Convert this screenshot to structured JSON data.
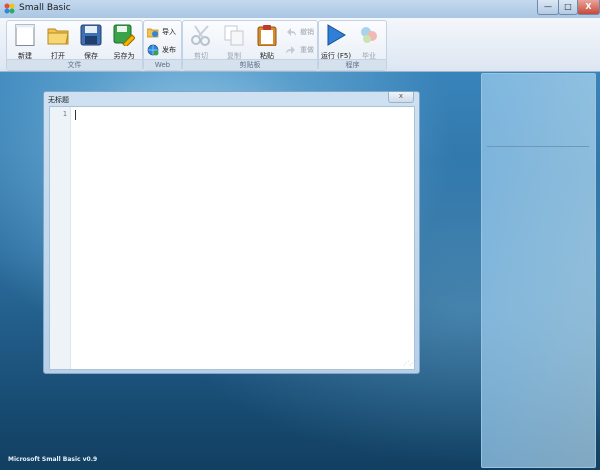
{
  "window": {
    "title": "Small Basic"
  },
  "window_controls": {
    "minimize": "—",
    "maximize": "□",
    "close": "X"
  },
  "ribbon": {
    "file_group": {
      "label": "文件",
      "new": "新建",
      "open": "打开",
      "save": "保存",
      "save_as": "另存为"
    },
    "web_group": {
      "label": "Web",
      "import": "导入",
      "publish": "发布"
    },
    "clipboard_group": {
      "label": "剪贴板",
      "cut": "剪切",
      "copy": "复制",
      "paste": "粘贴",
      "undo": "撤销",
      "redo": "重做"
    },
    "program_group": {
      "label": "程序",
      "run": "运行 (F5)",
      "graduate": "毕业"
    }
  },
  "editor": {
    "title": "无标题",
    "close_label": "x",
    "line_numbers": [
      "1"
    ]
  },
  "status": {
    "text": "Microsoft Small Basic v0.9"
  }
}
